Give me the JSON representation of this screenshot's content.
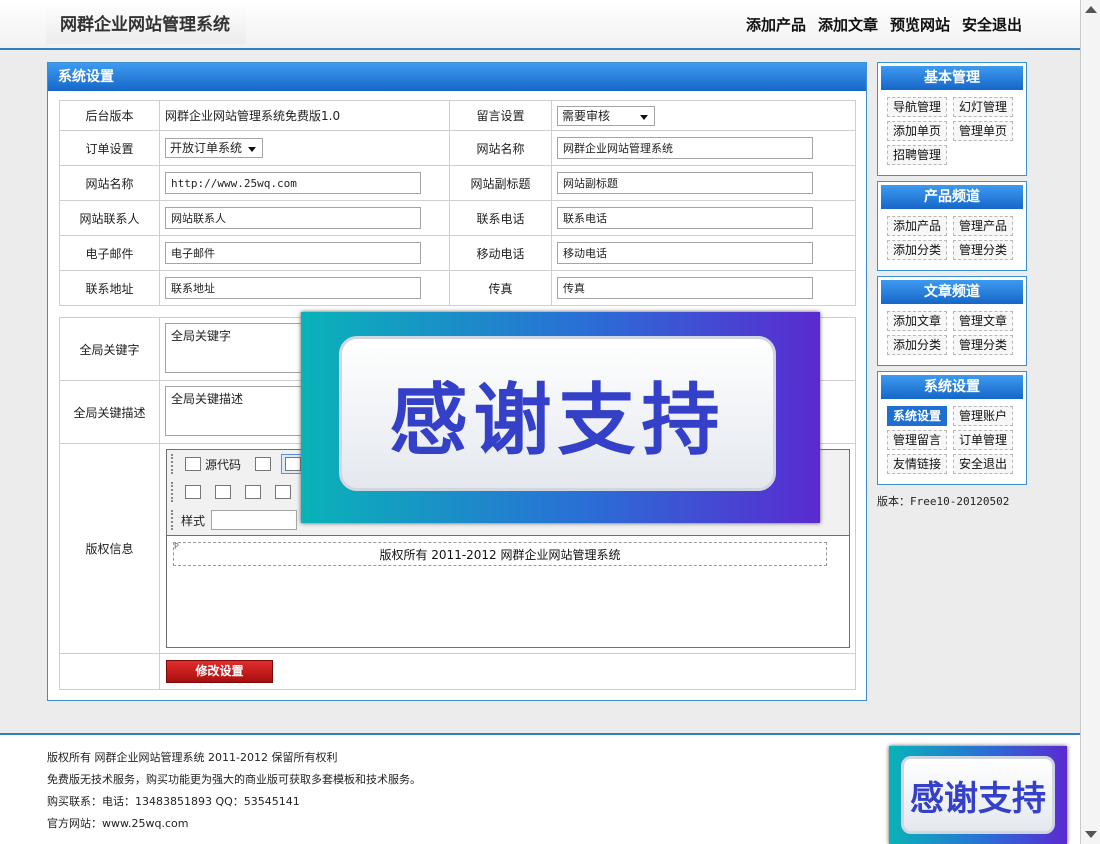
{
  "header": {
    "logo": "网群企业网站管理系统",
    "nav": [
      "添加产品",
      "添加文章",
      "预览网站",
      "安全退出"
    ]
  },
  "panel": {
    "title": "系统设置",
    "version_label": "后台版本",
    "version_value": "网群企业网站管理系统免费版1.0",
    "message_label": "留言设置",
    "message_value": "需要审核",
    "order_label": "订单设置",
    "order_value": "开放订单系统",
    "sitename_label": "网站名称",
    "sitename_value": "网群企业网站管理系统",
    "siteurl_label": "网站名称",
    "siteurl_value": "http://www.25wq.com",
    "subtitle_label": "网站副标题",
    "subtitle_value": "网站副标题",
    "contact_label": "网站联系人",
    "contact_value": "网站联系人",
    "phone_label": "联系电话",
    "phone_value": "联系电话",
    "email_label": "电子邮件",
    "email_value": "电子邮件",
    "mobile_label": "移动电话",
    "mobile_value": "移动电话",
    "address_label": "联系地址",
    "address_value": "联系地址",
    "fax_label": "传真",
    "fax_value": "传真",
    "keywords_label": "全局关键字",
    "keywords_value": "全局关键字",
    "desc_label": "全局关键描述",
    "desc_value": "全局关键描述",
    "copyright_label": "版权信息",
    "save_button": "修改设置"
  },
  "editor": {
    "source_label": "源代码",
    "style_label": "样式",
    "paragraph_mark": "P",
    "content": "版权所有  2011-2012 网群企业网站管理系统"
  },
  "sidebar": {
    "groups": [
      {
        "title": "基本管理",
        "items": [
          "导航管理",
          "幻灯管理",
          "添加单页",
          "管理单页",
          "招聘管理"
        ]
      },
      {
        "title": "产品频道",
        "items": [
          "添加产品",
          "管理产品",
          "添加分类",
          "管理分类"
        ]
      },
      {
        "title": "文章频道",
        "items": [
          "添加文章",
          "管理文章",
          "添加分类",
          "管理分类"
        ]
      },
      {
        "title": "系统设置",
        "items": [
          "系统设置",
          "管理账户",
          "管理留言",
          "订单管理",
          "友情链接",
          "安全退出"
        ]
      }
    ],
    "version": "版本：Free10-20120502"
  },
  "footer": {
    "line1": "版权所有  网群企业网站管理系统 2011-2012 保留所有权利",
    "line2": "免费版无技术服务，购买功能更为强大的商业版可获取多套模板和技术服务。",
    "line3": "购买联系：电话：13483851893 QQ：53545141",
    "line4": "官方网站：www.25wq.com"
  },
  "promo": {
    "text": "感谢支持"
  }
}
